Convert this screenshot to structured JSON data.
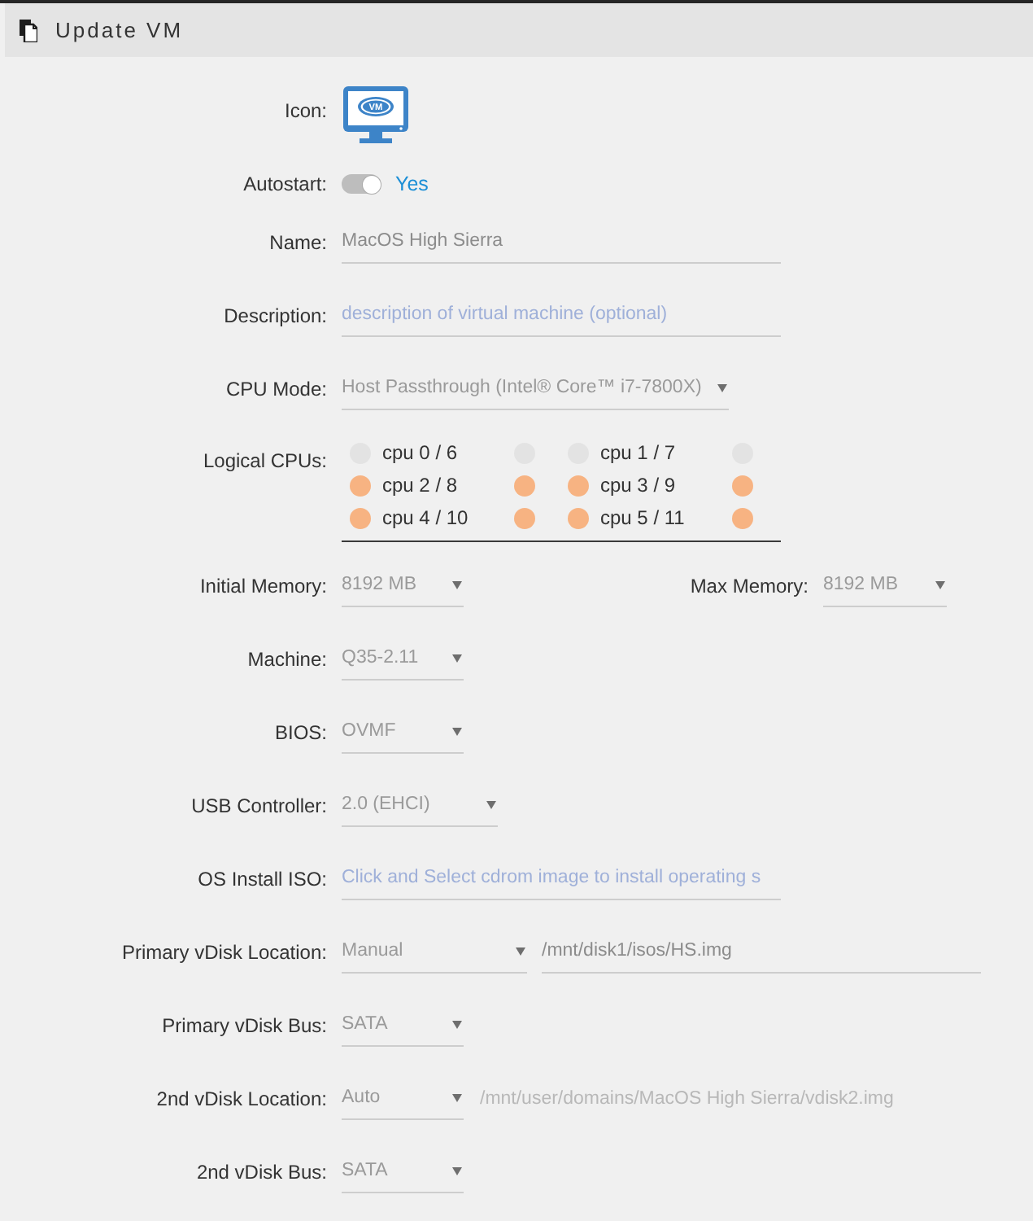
{
  "header": {
    "title": "Update VM"
  },
  "fields": [
    {
      "kind": "icon",
      "label": "Icon:",
      "icon_text": "VM"
    },
    {
      "kind": "toggle",
      "label": "Autostart:",
      "on": true,
      "value": "Yes"
    },
    {
      "kind": "text",
      "label": "Name:",
      "value": "MacOS High Sierra"
    },
    {
      "kind": "text",
      "label": "Description:",
      "placeholder": "description of virtual machine (optional)"
    },
    {
      "kind": "select",
      "label": "CPU Mode:",
      "value": "Host Passthrough (Intel® Core™ i7-7800X)"
    },
    {
      "kind": "cpus",
      "label": "Logical CPUs:",
      "cpus": [
        {
          "label": "cpu 0 / 6",
          "threads": [
            {
              "checked": false
            },
            {
              "checked": false
            }
          ]
        },
        {
          "label": "cpu 1 / 7",
          "threads": [
            {
              "checked": false
            },
            {
              "checked": false
            }
          ]
        },
        {
          "label": "cpu 2 / 8",
          "threads": [
            {
              "checked": true
            },
            {
              "checked": true
            }
          ]
        },
        {
          "label": "cpu 3 / 9",
          "threads": [
            {
              "checked": true
            },
            {
              "checked": true
            }
          ]
        },
        {
          "label": "cpu 4 / 10",
          "threads": [
            {
              "checked": true
            },
            {
              "checked": true
            }
          ]
        },
        {
          "label": "cpu 5 / 11",
          "threads": [
            {
              "checked": true
            },
            {
              "checked": true
            }
          ]
        }
      ]
    },
    {
      "kind": "pair",
      "items": [
        {
          "label": "Initial Memory:",
          "value": "8192 MB"
        },
        {
          "label": "Max Memory:",
          "value": "8192 MB"
        }
      ]
    },
    {
      "kind": "select",
      "label": "Machine:",
      "value": "Q35-2.11"
    },
    {
      "kind": "select",
      "label": "BIOS:",
      "value": "OVMF"
    },
    {
      "kind": "select",
      "label": "USB Controller:",
      "value": "2.0 (EHCI)"
    },
    {
      "kind": "text",
      "label": "OS Install ISO:",
      "placeholder": "Click and Select cdrom image to install operating s"
    },
    {
      "kind": "disk",
      "label": "Primary vDisk Location:",
      "value": "Manual",
      "path": "/mnt/disk1/isos/HS.img",
      "editable": true
    },
    {
      "kind": "select",
      "label": "Primary vDisk Bus:",
      "value": "SATA"
    },
    {
      "kind": "disk",
      "label": "2nd vDisk Location:",
      "value": "Auto",
      "path": "/mnt/user/domains/MacOS High Sierra/vdisk2.img",
      "editable": false
    },
    {
      "kind": "select",
      "label": "2nd vDisk Bus:",
      "value": "SATA"
    }
  ]
}
